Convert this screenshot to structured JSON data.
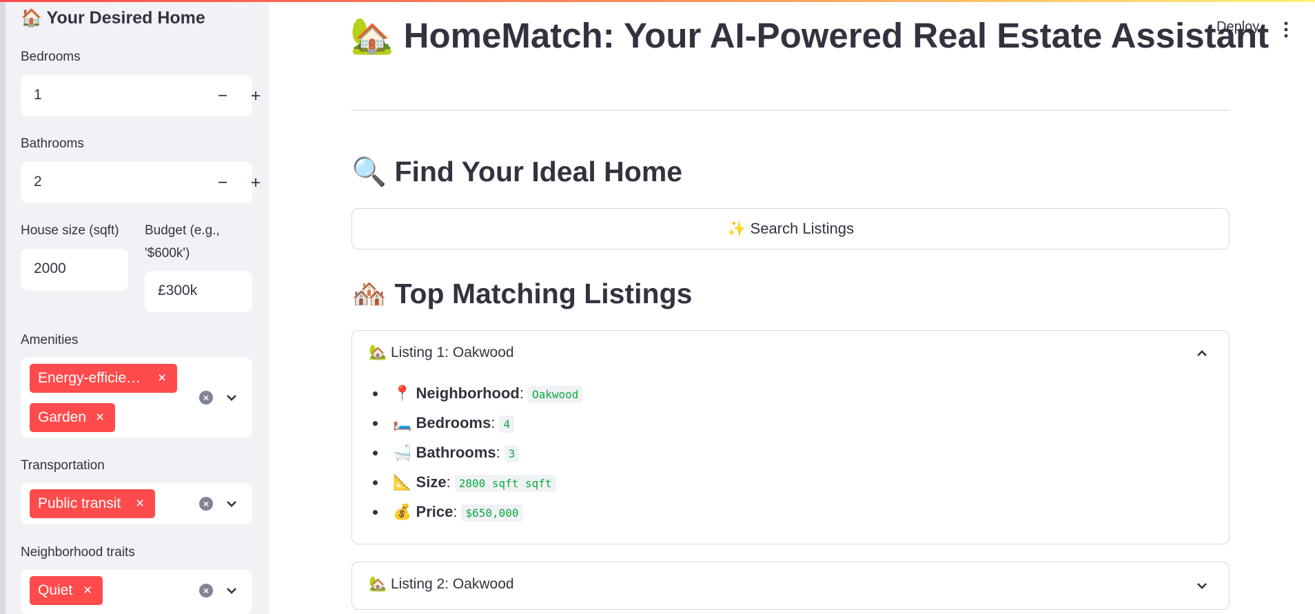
{
  "sidebar": {
    "title": "🏠 Your Desired Home",
    "bedrooms": {
      "label": "Bedrooms",
      "value": "1"
    },
    "bathrooms": {
      "label": "Bathrooms",
      "value": "2"
    },
    "house_size": {
      "label": "House size (sqft)",
      "value": "2000"
    },
    "budget": {
      "label_line1": "Budget (e.g.,",
      "label_line2": "'$600k')",
      "value": "£300k"
    },
    "amenities": {
      "label": "Amenities",
      "tags": [
        "Energy-efficie…",
        "Garden"
      ]
    },
    "transportation": {
      "label": "Transportation",
      "tags": [
        "Public transit"
      ]
    },
    "neighborhood": {
      "label": "Neighborhood traits",
      "tags": [
        "Quiet"
      ]
    },
    "stepper_minus": "−",
    "stepper_plus": "+",
    "tag_remove": "×"
  },
  "header": {
    "deploy_label": "Deploy"
  },
  "main": {
    "title": "🏡 HomeMatch: Your AI-Powered Real Estate Assistant",
    "find_heading": "🔍 Find Your Ideal Home",
    "search_button": "✨ Search Listings",
    "top_heading": "🏘️ Top Matching Listings",
    "listings": [
      {
        "title": "🏡 Listing 1: Oakwood",
        "expanded": true,
        "details": [
          {
            "icon": "📍",
            "key": "Neighborhood",
            "value": "Oakwood"
          },
          {
            "icon": "🛏️",
            "key": "Bedrooms",
            "value": "4"
          },
          {
            "icon": "🛁",
            "key": "Bathrooms",
            "value": "3"
          },
          {
            "icon": "📐",
            "key": "Size",
            "value": "2800 sqft sqft"
          },
          {
            "icon": "💰",
            "key": "Price",
            "value": "$650,000"
          }
        ]
      },
      {
        "title": "🏡 Listing 2: Oakwood",
        "expanded": false
      }
    ]
  },
  "colors": {
    "accent": "#ff4b4b",
    "code_text": "#09ab3b",
    "sidebar_bg": "#f0f2f6"
  }
}
